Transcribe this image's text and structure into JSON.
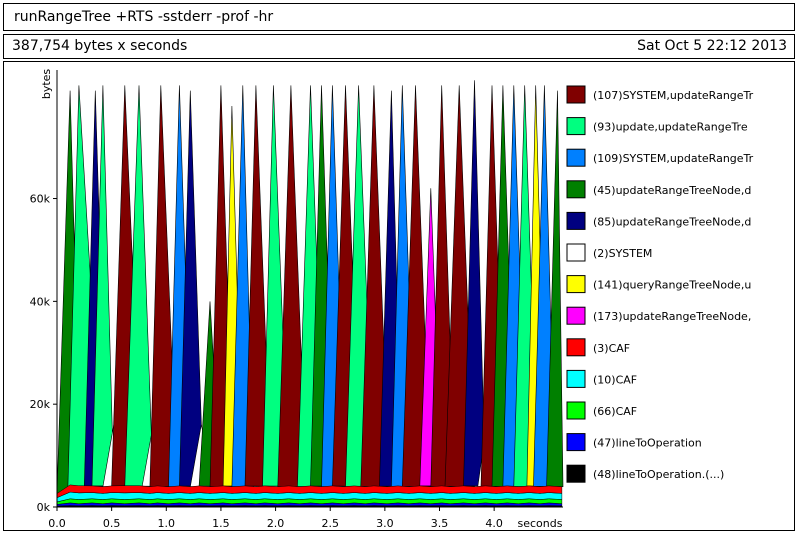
{
  "header": {
    "title": "runRangeTree +RTS -sstderr -prof -hr",
    "total": "387,754 bytes x seconds",
    "date": "Sat Oct  5 22:12 2013"
  },
  "chart_data": {
    "type": "area",
    "xlabel": "seconds",
    "ylabel": "bytes",
    "xlim": [
      0,
      4.63
    ],
    "ylim": [
      0,
      85000
    ],
    "x_ticks": [
      "0.0",
      "0.5",
      "1.0",
      "1.5",
      "2.0",
      "2.5",
      "3.0",
      "3.5",
      "4.0"
    ],
    "y_ticks": [
      "0k",
      "20k",
      "40k",
      "60k"
    ],
    "x": [
      0.0,
      0.12,
      0.2,
      0.32,
      0.42,
      0.5,
      0.62,
      0.75,
      0.85,
      0.92,
      1.02,
      1.12,
      1.22,
      1.3,
      1.4,
      1.52,
      1.6,
      1.72,
      1.82,
      1.9,
      2.02,
      2.12,
      2.22,
      2.32,
      2.42,
      2.52,
      2.62,
      2.72,
      2.82,
      2.9,
      3.02,
      3.12,
      3.22,
      3.32,
      3.42,
      3.52,
      3.6,
      3.72,
      3.82,
      3.92,
      4.02,
      4.12,
      4.22,
      4.32,
      4.42,
      4.5,
      4.62
    ],
    "base_layers": [
      {
        "name": "(3)CAF",
        "color": "#ff0000",
        "values": [
          800,
          1400,
          1400,
          1300,
          1300,
          1300,
          1400,
          1350,
          1300,
          1300,
          1300,
          1300,
          1300,
          1300,
          1300,
          1300,
          1300,
          1300,
          1300,
          1300,
          1300,
          1300,
          1300,
          1300,
          1300,
          1300,
          1300,
          1300,
          1300,
          1300,
          1300,
          1300,
          1300,
          1300,
          1300,
          1300,
          1300,
          1300,
          1300,
          1300,
          1300,
          1300,
          1300,
          1300,
          1300,
          1300,
          1300
        ]
      },
      {
        "name": "(10)CAF",
        "color": "#00ffff",
        "values": [
          800,
          1300,
          1300,
          1200,
          1200,
          1200,
          1300,
          1200,
          1200,
          1200,
          1200,
          1200,
          1200,
          1200,
          1200,
          1200,
          1200,
          1200,
          1200,
          1200,
          1200,
          1200,
          1200,
          1200,
          1200,
          1200,
          1200,
          1200,
          1200,
          1200,
          1200,
          1200,
          1200,
          1200,
          1200,
          1200,
          1200,
          1200,
          1200,
          1200,
          1200,
          1200,
          1200,
          1200,
          1200,
          1200,
          1200
        ]
      },
      {
        "name": "(66)CAF",
        "color": "#00ff00",
        "values": [
          500,
          800,
          800,
          800,
          800,
          800,
          800,
          800,
          800,
          800,
          800,
          800,
          800,
          800,
          800,
          800,
          800,
          800,
          800,
          800,
          800,
          800,
          800,
          800,
          800,
          800,
          800,
          800,
          800,
          800,
          800,
          800,
          800,
          800,
          800,
          800,
          800,
          800,
          800,
          800,
          800,
          800,
          800,
          800,
          800,
          800,
          800
        ]
      },
      {
        "name": "(47)lineToOperation",
        "color": "#0000ff",
        "values": [
          300,
          500,
          400,
          500,
          400,
          500,
          400,
          500,
          400,
          500,
          400,
          500,
          400,
          500,
          400,
          500,
          400,
          500,
          400,
          500,
          400,
          500,
          400,
          500,
          400,
          500,
          400,
          500,
          400,
          500,
          400,
          500,
          400,
          500,
          400,
          500,
          400,
          500,
          400,
          500,
          400,
          500,
          400,
          500,
          400,
          500,
          400
        ]
      },
      {
        "name": "(48)lineToOperation.(...)",
        "color": "#000000",
        "values": [
          200,
          300,
          250,
          300,
          250,
          300,
          250,
          300,
          250,
          300,
          250,
          300,
          250,
          300,
          250,
          300,
          250,
          300,
          250,
          300,
          250,
          300,
          250,
          300,
          250,
          300,
          250,
          300,
          250,
          300,
          250,
          300,
          250,
          300,
          250,
          300,
          250,
          300,
          250,
          300,
          250,
          300,
          250,
          300,
          250,
          300,
          250
        ]
      }
    ],
    "peaks": [
      {
        "name": "(45)updateRangeTreeNode,d",
        "color": "#008000",
        "x_start": 0.0,
        "x_peak": 0.12,
        "x_end": 0.22,
        "value": 81000
      },
      {
        "name": "(93)update,updateRangeTre",
        "color": "#00ff80",
        "x_start": 0.1,
        "x_peak": 0.2,
        "x_end": 0.42,
        "value": 82000
      },
      {
        "name": "(85)updateRangeTreeNode,d",
        "color": "#000080",
        "x_start": 0.25,
        "x_peak": 0.35,
        "x_end": 0.46,
        "value": 81000
      },
      {
        "name": "(93)update,updateRangeTre",
        "color": "#00ff80",
        "x_start": 0.32,
        "x_peak": 0.42,
        "x_end": 0.52,
        "value": 82000
      },
      {
        "name": "(2)SYSTEM",
        "color": "#ffffff",
        "x_start": 0.42,
        "x_peak": 0.52,
        "x_end": 0.65,
        "value": 16000
      },
      {
        "name": "(107)SYSTEM,updateRangeTr",
        "color": "#800000",
        "x_start": 0.5,
        "x_peak": 0.62,
        "x_end": 0.78,
        "value": 82000
      },
      {
        "name": "(93)update,updateRangeTre",
        "color": "#00ff80",
        "x_start": 0.62,
        "x_peak": 0.75,
        "x_end": 0.88,
        "value": 82000
      },
      {
        "name": "(2)SYSTEM",
        "color": "#ffffff",
        "x_start": 0.78,
        "x_peak": 0.88,
        "x_end": 1.0,
        "value": 16000
      },
      {
        "name": "(107)SYSTEM,updateRangeTr",
        "color": "#800000",
        "x_start": 0.85,
        "x_peak": 0.95,
        "x_end": 1.1,
        "value": 82000
      },
      {
        "name": "(109)SYSTEM,updateRangeTr",
        "color": "#0080ff",
        "x_start": 1.02,
        "x_peak": 1.12,
        "x_end": 1.24,
        "value": 82000
      },
      {
        "name": "(85)updateRangeTreeNode,d",
        "color": "#000080",
        "x_start": 1.12,
        "x_peak": 1.22,
        "x_end": 1.34,
        "value": 81000
      },
      {
        "name": "(2)SYSTEM",
        "color": "#ffffff",
        "x_start": 1.22,
        "x_peak": 1.32,
        "x_end": 1.44,
        "value": 16000
      },
      {
        "name": "(45)updateRangeTreeNode,d",
        "color": "#008000",
        "x_start": 1.3,
        "x_peak": 1.4,
        "x_end": 1.5,
        "value": 40000
      },
      {
        "name": "(107)SYSTEM,updateRangeTr",
        "color": "#800000",
        "x_start": 1.4,
        "x_peak": 1.5,
        "x_end": 1.62,
        "value": 82000
      },
      {
        "name": "(141)queryRangeTreeNode,u",
        "color": "#ffff00",
        "x_start": 1.52,
        "x_peak": 1.6,
        "x_end": 1.7,
        "value": 78000
      },
      {
        "name": "(109)SYSTEM,updateRangeTr",
        "color": "#0080ff",
        "x_start": 1.6,
        "x_peak": 1.7,
        "x_end": 1.8,
        "value": 82000
      },
      {
        "name": "(107)SYSTEM,updateRangeTr",
        "color": "#800000",
        "x_start": 1.72,
        "x_peak": 1.82,
        "x_end": 1.96,
        "value": 82000
      },
      {
        "name": "(93)update,updateRangeTre",
        "color": "#00ff80",
        "x_start": 1.88,
        "x_peak": 1.98,
        "x_end": 2.12,
        "value": 82000
      },
      {
        "name": "(107)SYSTEM,updateRangeTr",
        "color": "#800000",
        "x_start": 2.02,
        "x_peak": 2.14,
        "x_end": 2.28,
        "value": 82000
      },
      {
        "name": "(93)update,updateRangeTre",
        "color": "#00ff80",
        "x_start": 2.2,
        "x_peak": 2.32,
        "x_end": 2.45,
        "value": 82000
      },
      {
        "name": "(45)updateRangeTreeNode,d",
        "color": "#008000",
        "x_start": 2.32,
        "x_peak": 2.42,
        "x_end": 2.54,
        "value": 82000
      },
      {
        "name": "(109)SYSTEM,updateRangeTr",
        "color": "#0080ff",
        "x_start": 2.42,
        "x_peak": 2.52,
        "x_end": 2.64,
        "value": 82000
      },
      {
        "name": "(107)SYSTEM,updateRangeTr",
        "color": "#800000",
        "x_start": 2.52,
        "x_peak": 2.64,
        "x_end": 2.78,
        "value": 82000
      },
      {
        "name": "(93)update,updateRangeTre",
        "color": "#00ff80",
        "x_start": 2.64,
        "x_peak": 2.76,
        "x_end": 2.9,
        "value": 82000
      },
      {
        "name": "(107)SYSTEM,updateRangeTr",
        "color": "#800000",
        "x_start": 2.78,
        "x_peak": 2.9,
        "x_end": 3.04,
        "value": 82000
      },
      {
        "name": "(85)updateRangeTreeNode,d",
        "color": "#000080",
        "x_start": 2.95,
        "x_peak": 3.06,
        "x_end": 3.16,
        "value": 81000
      },
      {
        "name": "(109)SYSTEM,updateRangeTr",
        "color": "#0080ff",
        "x_start": 3.06,
        "x_peak": 3.16,
        "x_end": 3.28,
        "value": 82000
      },
      {
        "name": "(107)SYSTEM,updateRangeTr",
        "color": "#800000",
        "x_start": 3.16,
        "x_peak": 3.28,
        "x_end": 3.42,
        "value": 82000
      },
      {
        "name": "(173)updateRangeTreeNode,",
        "color": "#ff00ff",
        "x_start": 3.32,
        "x_peak": 3.42,
        "x_end": 3.52,
        "value": 62000
      },
      {
        "name": "(107)SYSTEM,updateRangeTr",
        "color": "#800000",
        "x_start": 3.42,
        "x_peak": 3.52,
        "x_end": 3.64,
        "value": 82000
      },
      {
        "name": "(107)SYSTEM,updateRangeTr",
        "color": "#800000",
        "x_start": 3.55,
        "x_peak": 3.68,
        "x_end": 3.82,
        "value": 82000
      },
      {
        "name": "(85)updateRangeTreeNode,d",
        "color": "#000080",
        "x_start": 3.72,
        "x_peak": 3.82,
        "x_end": 3.92,
        "value": 83000
      },
      {
        "name": "(2)SYSTEM",
        "color": "#ffffff",
        "x_start": 3.85,
        "x_peak": 3.93,
        "x_end": 4.02,
        "value": 16000
      },
      {
        "name": "(107)SYSTEM,updateRangeTr",
        "color": "#800000",
        "x_start": 3.88,
        "x_peak": 3.98,
        "x_end": 4.1,
        "value": 82000
      },
      {
        "name": "(45)updateRangeTreeNode,d",
        "color": "#008000",
        "x_start": 3.98,
        "x_peak": 4.08,
        "x_end": 4.2,
        "value": 82000
      },
      {
        "name": "(109)SYSTEM,updateRangeTr",
        "color": "#0080ff",
        "x_start": 4.08,
        "x_peak": 4.18,
        "x_end": 4.3,
        "value": 82000
      },
      {
        "name": "(93)update,updateRangeTre",
        "color": "#00ff80",
        "x_start": 4.18,
        "x_peak": 4.28,
        "x_end": 4.4,
        "value": 82000
      },
      {
        "name": "(141)queryRangeTreeNode,u",
        "color": "#ffff00",
        "x_start": 4.3,
        "x_peak": 4.38,
        "x_end": 4.48,
        "value": 82000
      },
      {
        "name": "(109)SYSTEM,updateRangeTr",
        "color": "#0080ff",
        "x_start": 4.36,
        "x_peak": 4.46,
        "x_end": 4.56,
        "value": 82000
      },
      {
        "name": "(45)updateRangeTreeNode,d",
        "color": "#008000",
        "x_start": 4.48,
        "x_peak": 4.58,
        "x_end": 4.63,
        "value": 81000
      }
    ],
    "legend": [
      {
        "label": "(107)SYSTEM,updateRangeTr",
        "color": "#800000"
      },
      {
        "label": "(93)update,updateRangeTre",
        "color": "#00ff80"
      },
      {
        "label": "(109)SYSTEM,updateRangeTr",
        "color": "#0080ff"
      },
      {
        "label": "(45)updateRangeTreeNode,d",
        "color": "#008000"
      },
      {
        "label": "(85)updateRangeTreeNode,d",
        "color": "#000080"
      },
      {
        "label": "(2)SYSTEM",
        "color": "#ffffff"
      },
      {
        "label": "(141)queryRangeTreeNode,u",
        "color": "#ffff00"
      },
      {
        "label": "(173)updateRangeTreeNode,",
        "color": "#ff00ff"
      },
      {
        "label": "(3)CAF",
        "color": "#ff0000"
      },
      {
        "label": "(10)CAF",
        "color": "#00ffff"
      },
      {
        "label": "(66)CAF",
        "color": "#00ff00"
      },
      {
        "label": "(47)lineToOperation",
        "color": "#0000ff"
      },
      {
        "label": "(48)lineToOperation.(...)",
        "color": "#000000"
      }
    ],
    "legend_position": "right"
  }
}
